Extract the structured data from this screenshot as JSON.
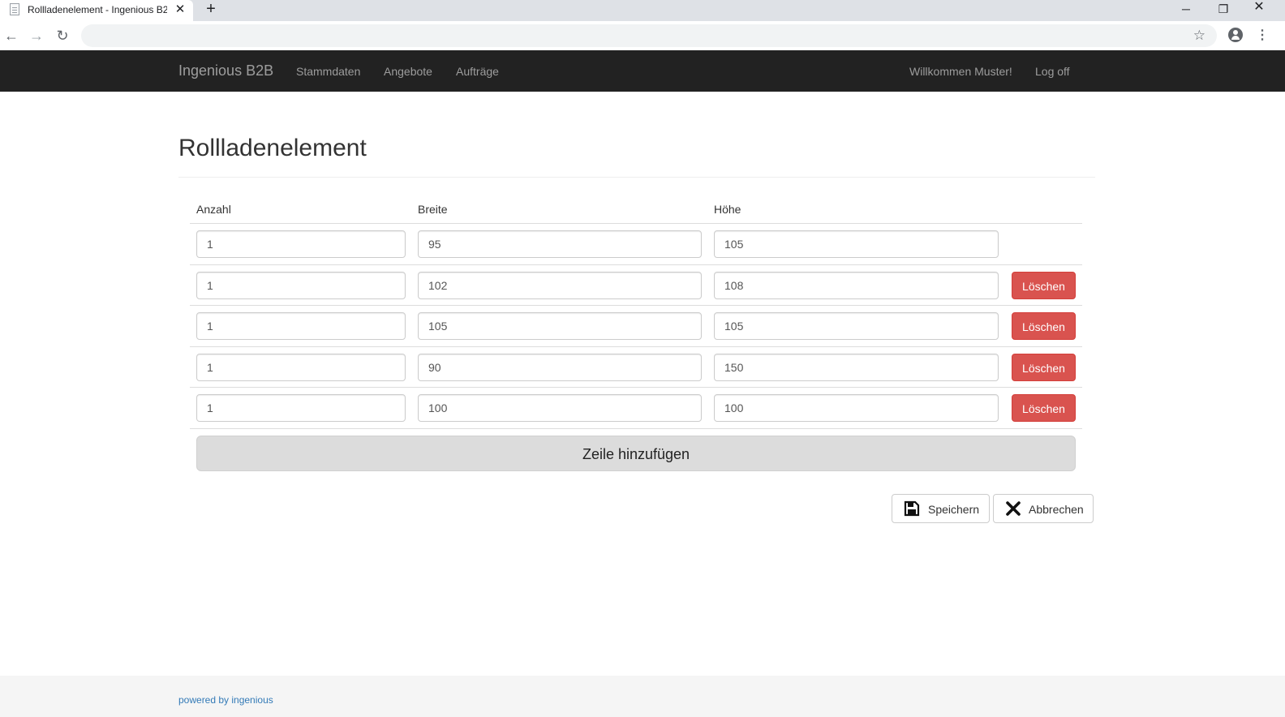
{
  "browser": {
    "tab_title": "Rollladenelement - Ingenious B2B",
    "tab_close": "✕",
    "new_tab": "+",
    "win_minimize": "─",
    "win_restore": "❐",
    "win_close": "✕",
    "back": "←",
    "forward": "→",
    "reload": "↻",
    "bookmark": "☆",
    "menu": "⋮"
  },
  "navbar": {
    "brand": "Ingenious B2B",
    "links": [
      "Stammdaten",
      "Angebote",
      "Aufträge"
    ],
    "welcome": "Willkommen Muster!",
    "logoff": "Log off"
  },
  "main": {
    "title": "Rollladenelement",
    "columns": [
      "Anzahl",
      "Breite",
      "Höhe"
    ],
    "rows": [
      {
        "anzahl": "1",
        "breite": "95",
        "hoehe": "105"
      },
      {
        "anzahl": "1",
        "breite": "102",
        "hoehe": "108",
        "delete_label": "Löschen"
      },
      {
        "anzahl": "1",
        "breite": "105",
        "hoehe": "105",
        "delete_label": "Löschen"
      },
      {
        "anzahl": "1",
        "breite": "90",
        "hoehe": "150",
        "delete_label": "Löschen"
      },
      {
        "anzahl": "1",
        "breite": "100",
        "hoehe": "100",
        "delete_label": "Löschen"
      }
    ],
    "add_row_label": "Zeile hinzufügen",
    "save_label": "Speichern",
    "cancel_label": "Abbrechen"
  },
  "footer": {
    "text": "powered by ingenious"
  },
  "colors": {
    "navbar_bg": "#222222",
    "danger": "#d9534f",
    "link": "#337ab7"
  },
  "icons": {
    "save": "floppy-disk-icon",
    "cancel": "close-x-icon"
  }
}
